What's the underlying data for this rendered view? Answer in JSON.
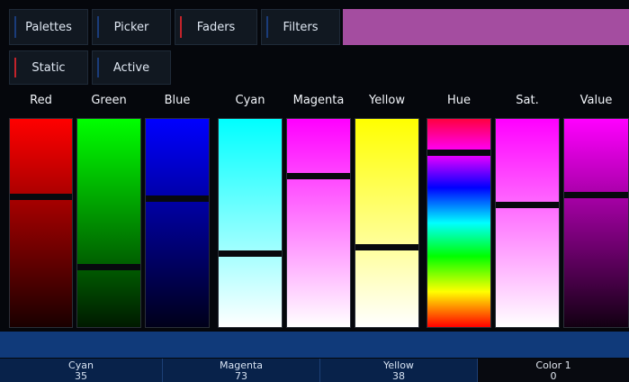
{
  "tabs": {
    "row1": [
      {
        "key": "palettes",
        "label": "Palettes",
        "active": false
      },
      {
        "key": "picker",
        "label": "Picker",
        "active": false
      },
      {
        "key": "faders",
        "label": "Faders",
        "active": true
      },
      {
        "key": "filters",
        "label": "Filters",
        "active": false
      }
    ],
    "row2": [
      {
        "key": "static",
        "label": "Static",
        "active": true
      },
      {
        "key": "active",
        "label": "Active",
        "active": false
      }
    ]
  },
  "current_color": "#a44da0",
  "faders": [
    {
      "key": "red",
      "label": "Red",
      "level": 0.63
    },
    {
      "key": "green",
      "label": "Green",
      "level": 0.28
    },
    {
      "key": "blue",
      "label": "Blue",
      "level": 0.62
    },
    {
      "key": "cyan",
      "label": "Cyan",
      "level": 0.35
    },
    {
      "key": "magenta",
      "label": "Magenta",
      "level": 0.73
    },
    {
      "key": "yellow",
      "label": "Yellow",
      "level": 0.38
    },
    {
      "key": "hue",
      "label": "Hue",
      "level": 0.85
    },
    {
      "key": "sat",
      "label": "Sat.",
      "level": 0.59
    },
    {
      "key": "value",
      "label": "Value",
      "level": 0.64
    }
  ],
  "readouts": [
    {
      "key": "cyan",
      "label": "Cyan",
      "value": "35"
    },
    {
      "key": "magenta",
      "label": "Magenta",
      "value": "73"
    },
    {
      "key": "yellow",
      "label": "Yellow",
      "value": "38"
    },
    {
      "key": "color1",
      "label": "Color 1",
      "value": "0"
    }
  ]
}
